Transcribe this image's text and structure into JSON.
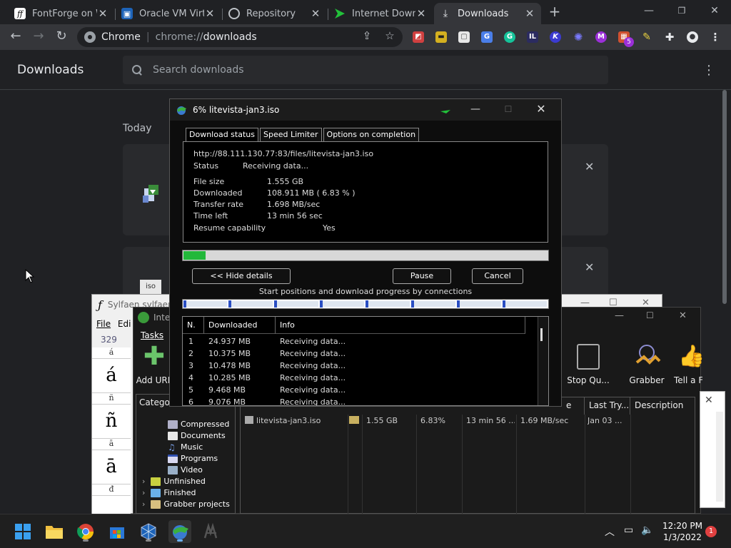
{
  "browser": {
    "tabs": [
      {
        "label": "FontForge on W",
        "icon": "fontforge-icon"
      },
      {
        "label": "Oracle VM Virtu",
        "icon": "virtualbox-icon"
      },
      {
        "label": "Repository",
        "icon": "globe-icon"
      },
      {
        "label": "Internet Downl",
        "icon": "idm-green-arrow-icon"
      },
      {
        "label": "Downloads",
        "icon": "download-icon",
        "active": true
      }
    ],
    "new_tab": "+",
    "omnibox": {
      "site": "Chrome",
      "url_scheme": "chrome://",
      "url_path": "downloads"
    },
    "extension_badge": "5"
  },
  "downloads_page": {
    "title": "Downloads",
    "search_placeholder": "Search downloads",
    "section": "Today"
  },
  "idm_dialog": {
    "title": "6% litevista-jan3.iso",
    "tabs": [
      "Download status",
      "Speed Limiter",
      "Options on completion"
    ],
    "url": "http://88.111.130.77:83/files/litevista-jan3.iso",
    "status_label": "Status",
    "status_value": "Receiving data...",
    "file_size_label": "File size",
    "file_size_value": "1.555  GB",
    "downloaded_label": "Downloaded",
    "downloaded_value": "108.911  MB  ( 6.83 % )",
    "transfer_rate_label": "Transfer rate",
    "transfer_rate_value": "1.698  MB/sec",
    "time_left_label": "Time left",
    "time_left_value": "13 min 56 sec",
    "resume_label": "Resume capability",
    "resume_value": "Yes",
    "progress_fraction": 0.0683,
    "hide_details": "<< Hide details",
    "pause": "Pause",
    "cancel": "Cancel",
    "connections_caption": "Start positions and download progress by connections",
    "list_headers": [
      "N.",
      "Downloaded",
      "Info"
    ],
    "connections": [
      {
        "n": "1",
        "downloaded": "24.937  MB",
        "info": "Receiving data..."
      },
      {
        "n": "2",
        "downloaded": "10.375  MB",
        "info": "Receiving data..."
      },
      {
        "n": "3",
        "downloaded": "10.478  MB",
        "info": "Receiving data..."
      },
      {
        "n": "4",
        "downloaded": "10.285  MB",
        "info": "Receiving data..."
      },
      {
        "n": "5",
        "downloaded": "9.468  MB",
        "info": "Receiving data..."
      },
      {
        "n": "6",
        "downloaded": "9.076  MB",
        "info": "Receiving data..."
      }
    ]
  },
  "fontforge_window": {
    "title": "Sylfaen  sylfaen",
    "menu": [
      "File",
      "Edi"
    ],
    "code": "329",
    "glyphs": [
      {
        "small": "á",
        "big": "á"
      },
      {
        "small": "ñ",
        "big": "ñ"
      },
      {
        "small": "ā",
        "big": "ā"
      },
      {
        "small": "đ",
        "big": "đ"
      }
    ]
  },
  "idm_main": {
    "title": "Inter",
    "menu": "Tasks",
    "toolbar": {
      "add_url": "Add URL",
      "stop_queue": "Stop Qu...",
      "grabber": "Grabber",
      "tell_friend": "Tell a Fr"
    },
    "categories_header": "Categor",
    "categories": [
      "Compressed",
      "Documents",
      "Music",
      "Programs",
      "Video",
      "Unfinished",
      "Finished",
      "Grabber projects"
    ],
    "list_headers": {
      "e": "e",
      "last_try": "Last Try...",
      "description": "Description"
    },
    "row": {
      "name": "litevista-jan3.iso",
      "size": "1.55  GB",
      "percent": "6.83%",
      "time_left": "13 min 56 ...",
      "rate": "1.69  MB/sec",
      "last_try": "Jan 03 ..."
    }
  },
  "taskbar": {
    "time": "12:20 PM",
    "date": "1/3/2022",
    "notifications": "1"
  }
}
